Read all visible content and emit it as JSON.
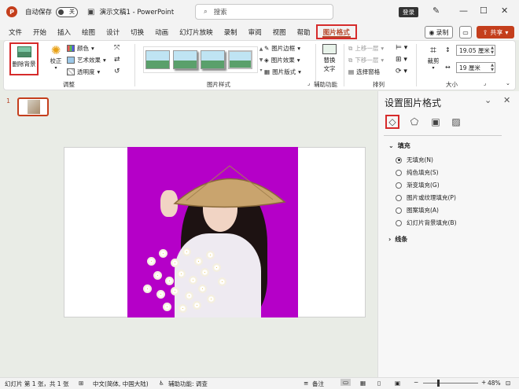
{
  "titlebar": {
    "autosave_label": "自动保存",
    "autosave_state": "关",
    "doc_title": "演示文稿1 - PowerPoint",
    "search_placeholder": "搜索",
    "login_label": "登录",
    "app_logo": "P"
  },
  "tabs": [
    "文件",
    "开始",
    "插入",
    "绘图",
    "设计",
    "切换",
    "动画",
    "幻灯片放映",
    "录制",
    "审阅",
    "视图",
    "帮助",
    "图片格式"
  ],
  "menubar": {
    "record_label": "录制",
    "share_label": "共享"
  },
  "ribbon": {
    "adjust": {
      "remove_bg": "删除背景",
      "correct": "校正",
      "color": "颜色",
      "artistic": "艺术效果",
      "transparency": "透明度",
      "label": "调整"
    },
    "styles": {
      "border": "图片边框",
      "effects": "图片效果",
      "layout": "图片版式",
      "label": "图片样式"
    },
    "accessibility": {
      "alt_text_line1": "替换",
      "alt_text_line2": "文字",
      "label": "辅助功能"
    },
    "arrange": {
      "bring_forward": "上移一层",
      "send_backward": "下移一层",
      "selection_pane": "选择窗格",
      "label": "排列"
    },
    "size": {
      "crop": "裁剪",
      "height": "19.05 厘米",
      "width": "19 厘米",
      "label": "大小"
    }
  },
  "thumbnail": {
    "number": "1"
  },
  "format_pane": {
    "title": "设置图片格式",
    "fill_section": "填充",
    "fill_options": [
      "无填充(N)",
      "纯色填充(S)",
      "渐变填充(G)",
      "图片或纹理填充(P)",
      "图案填充(A)",
      "幻灯片背景填充(B)"
    ],
    "line_section": "线条"
  },
  "statusbar": {
    "slide_info": "幻灯片 第 1 张，共 1 张",
    "language": "中文(简体, 中国大陆)",
    "accessibility": "辅助功能: 调查",
    "notes": "备注",
    "zoom": "48%"
  },
  "colors": {
    "accent": "#c43e1c",
    "highlight_border": "#d62b2b",
    "photo_bg": "#b500c8"
  }
}
